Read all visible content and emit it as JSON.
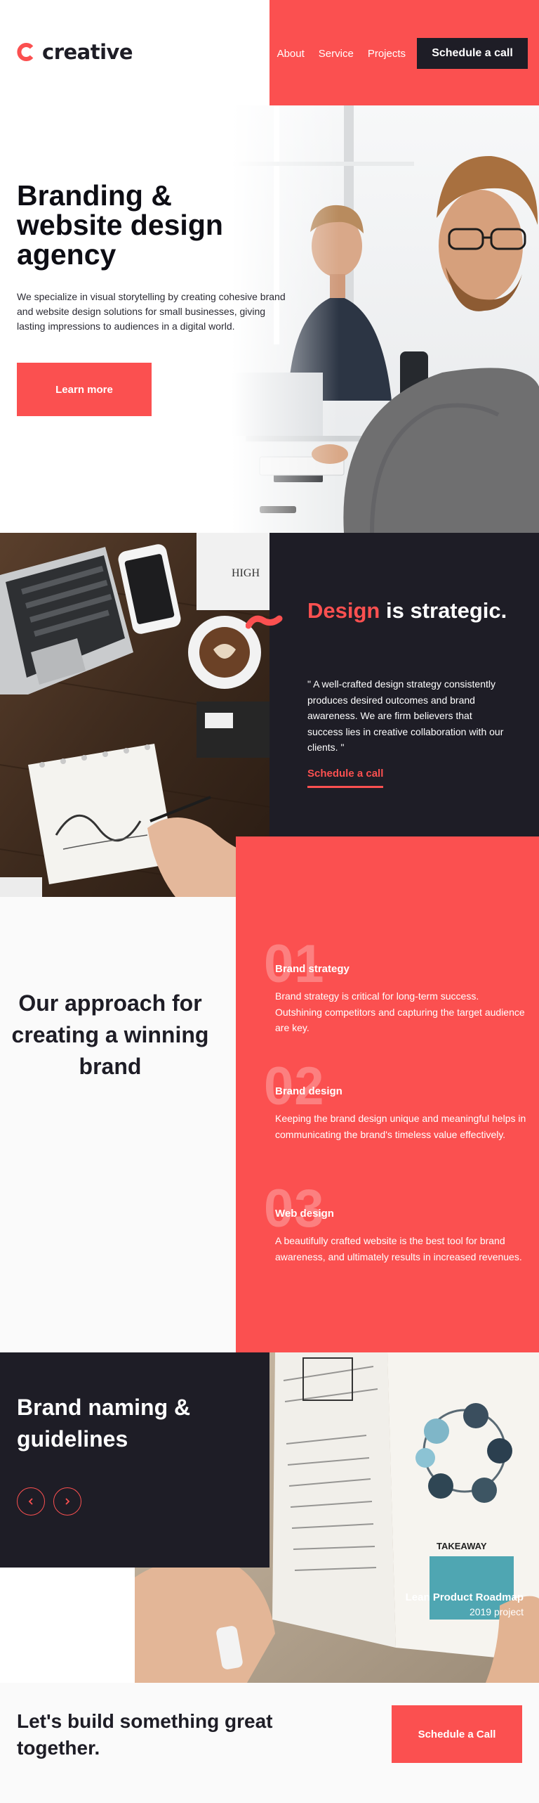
{
  "header": {
    "logo_text": "creative",
    "nav": [
      {
        "label": "About"
      },
      {
        "label": "Service"
      },
      {
        "label": "Projects"
      }
    ],
    "cta_label": "Schedule a call"
  },
  "hero": {
    "title": "Branding & website design agency",
    "subtitle": "We specialize in visual storytelling by creating cohesive brand and website design solutions for small businesses, giving lasting impressions to audiences in a digital world.",
    "button_label": "Learn more"
  },
  "strategy": {
    "title_accent": "Design",
    "title_rest": " is strategic.",
    "quote": "\" A well-crafted design strategy consistently produces desired outcomes and brand awareness. We are firm believers that success lies in creative collaboration with our clients. \"",
    "link_label": "Schedule a call"
  },
  "approach": {
    "title": "Our approach for creating a winning brand",
    "steps": [
      {
        "number": "01",
        "title": "Brand strategy",
        "description": "Brand strategy is critical for long-term success. Outshining competitors and capturing the target audience are key."
      },
      {
        "number": "02",
        "title": "Brand design",
        "description": "Keeping the brand design unique and meaningful helps in communicating the brand's timeless value effectively."
      },
      {
        "number": "03",
        "title": "Web design",
        "description": "A beautifully crafted website is the best tool for brand awareness, and ultimately results in increased revenues."
      }
    ]
  },
  "naming": {
    "title": "Brand naming & guidelines",
    "caption_title": "Lean Product Roadmap",
    "caption_sub": "2019 project"
  },
  "footer": {
    "title": "Let's build something great together.",
    "button_label": "Schedule a Call"
  },
  "colors": {
    "accent": "#fb5050",
    "dark": "#1e1d26",
    "light": "#fafafa"
  },
  "icons": [
    "logo-mark-icon",
    "arrow-left-icon",
    "arrow-right-icon"
  ]
}
